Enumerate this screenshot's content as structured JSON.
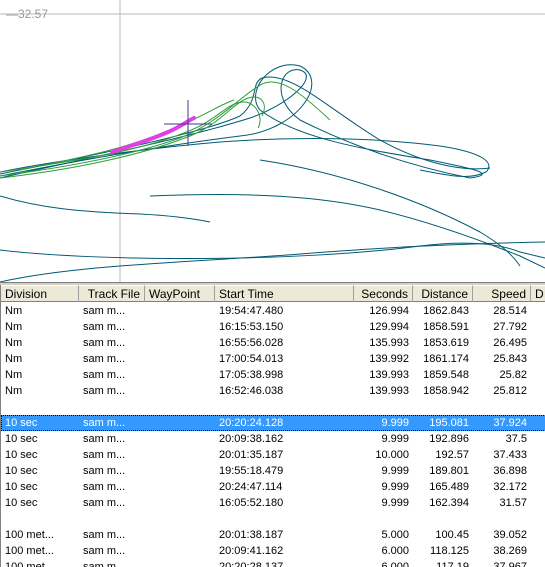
{
  "plot": {
    "y_axis_value": "32.57",
    "colors": {
      "background": "#ffffff",
      "track_dark": "#005a73",
      "track_green": "#2e9e3a",
      "highlight": "#e040e0",
      "crosshair": "#3a3a9a",
      "gridline": "#b8b8b8"
    }
  },
  "table": {
    "columns": [
      "Division",
      "Track File",
      "WayPoint",
      "Start Time",
      "Seconds",
      "Distance",
      "Speed",
      "D"
    ],
    "rows": [
      {
        "division": "Nm",
        "track": "sam m...",
        "waypoint": "",
        "start": "19:54:47.480",
        "seconds": "126.994",
        "distance": "1862.843",
        "speed": "28.514",
        "selected": false
      },
      {
        "division": "Nm",
        "track": "sam m...",
        "waypoint": "",
        "start": "16:15:53.150",
        "seconds": "129.994",
        "distance": "1858.591",
        "speed": "27.792",
        "selected": false
      },
      {
        "division": "Nm",
        "track": "sam m...",
        "waypoint": "",
        "start": "16:55:56.028",
        "seconds": "135.993",
        "distance": "1853.619",
        "speed": "26.495",
        "selected": false
      },
      {
        "division": "Nm",
        "track": "sam m...",
        "waypoint": "",
        "start": "17:00:54.013",
        "seconds": "139.992",
        "distance": "1861.174",
        "speed": "25.843",
        "selected": false
      },
      {
        "division": "Nm",
        "track": "sam m...",
        "waypoint": "",
        "start": "17:05:38.998",
        "seconds": "139.993",
        "distance": "1859.548",
        "speed": "25.82",
        "selected": false
      },
      {
        "division": "Nm",
        "track": "sam m...",
        "waypoint": "",
        "start": "16:52:46.038",
        "seconds": "139.993",
        "distance": "1858.942",
        "speed": "25.812",
        "selected": false
      },
      {
        "division": "",
        "track": "",
        "waypoint": "",
        "start": "",
        "seconds": "",
        "distance": "",
        "speed": "",
        "selected": false
      },
      {
        "division": "10 sec",
        "track": "sam m...",
        "waypoint": "",
        "start": "20:20:24.128",
        "seconds": "9.999",
        "distance": "195.081",
        "speed": "37.924",
        "selected": true
      },
      {
        "division": "10 sec",
        "track": "sam m...",
        "waypoint": "",
        "start": "20:09:38.162",
        "seconds": "9.999",
        "distance": "192.896",
        "speed": "37.5",
        "selected": false
      },
      {
        "division": "10 sec",
        "track": "sam m...",
        "waypoint": "",
        "start": "20:01:35.187",
        "seconds": "10.000",
        "distance": "192.57",
        "speed": "37.433",
        "selected": false
      },
      {
        "division": "10 sec",
        "track": "sam m...",
        "waypoint": "",
        "start": "19:55:18.479",
        "seconds": "9.999",
        "distance": "189.801",
        "speed": "36.898",
        "selected": false
      },
      {
        "division": "10 sec",
        "track": "sam m...",
        "waypoint": "",
        "start": "20:24:47.114",
        "seconds": "9.999",
        "distance": "165.489",
        "speed": "32.172",
        "selected": false
      },
      {
        "division": "10 sec",
        "track": "sam m...",
        "waypoint": "",
        "start": "16:05:52.180",
        "seconds": "9.999",
        "distance": "162.394",
        "speed": "31.57",
        "selected": false
      },
      {
        "division": "",
        "track": "",
        "waypoint": "",
        "start": "",
        "seconds": "",
        "distance": "",
        "speed": "",
        "selected": false
      },
      {
        "division": "100 met...",
        "track": "sam m...",
        "waypoint": "",
        "start": "20:01:38.187",
        "seconds": "5.000",
        "distance": "100.45",
        "speed": "39.052",
        "selected": false
      },
      {
        "division": "100 met...",
        "track": "sam m...",
        "waypoint": "",
        "start": "20:09:41.162",
        "seconds": "6.000",
        "distance": "118.125",
        "speed": "38.269",
        "selected": false
      },
      {
        "division": "100 met...",
        "track": "sam m...",
        "waypoint": "",
        "start": "20:20:28.137",
        "seconds": "6.000",
        "distance": "117.19",
        "speed": "37.967",
        "selected": false
      }
    ]
  }
}
